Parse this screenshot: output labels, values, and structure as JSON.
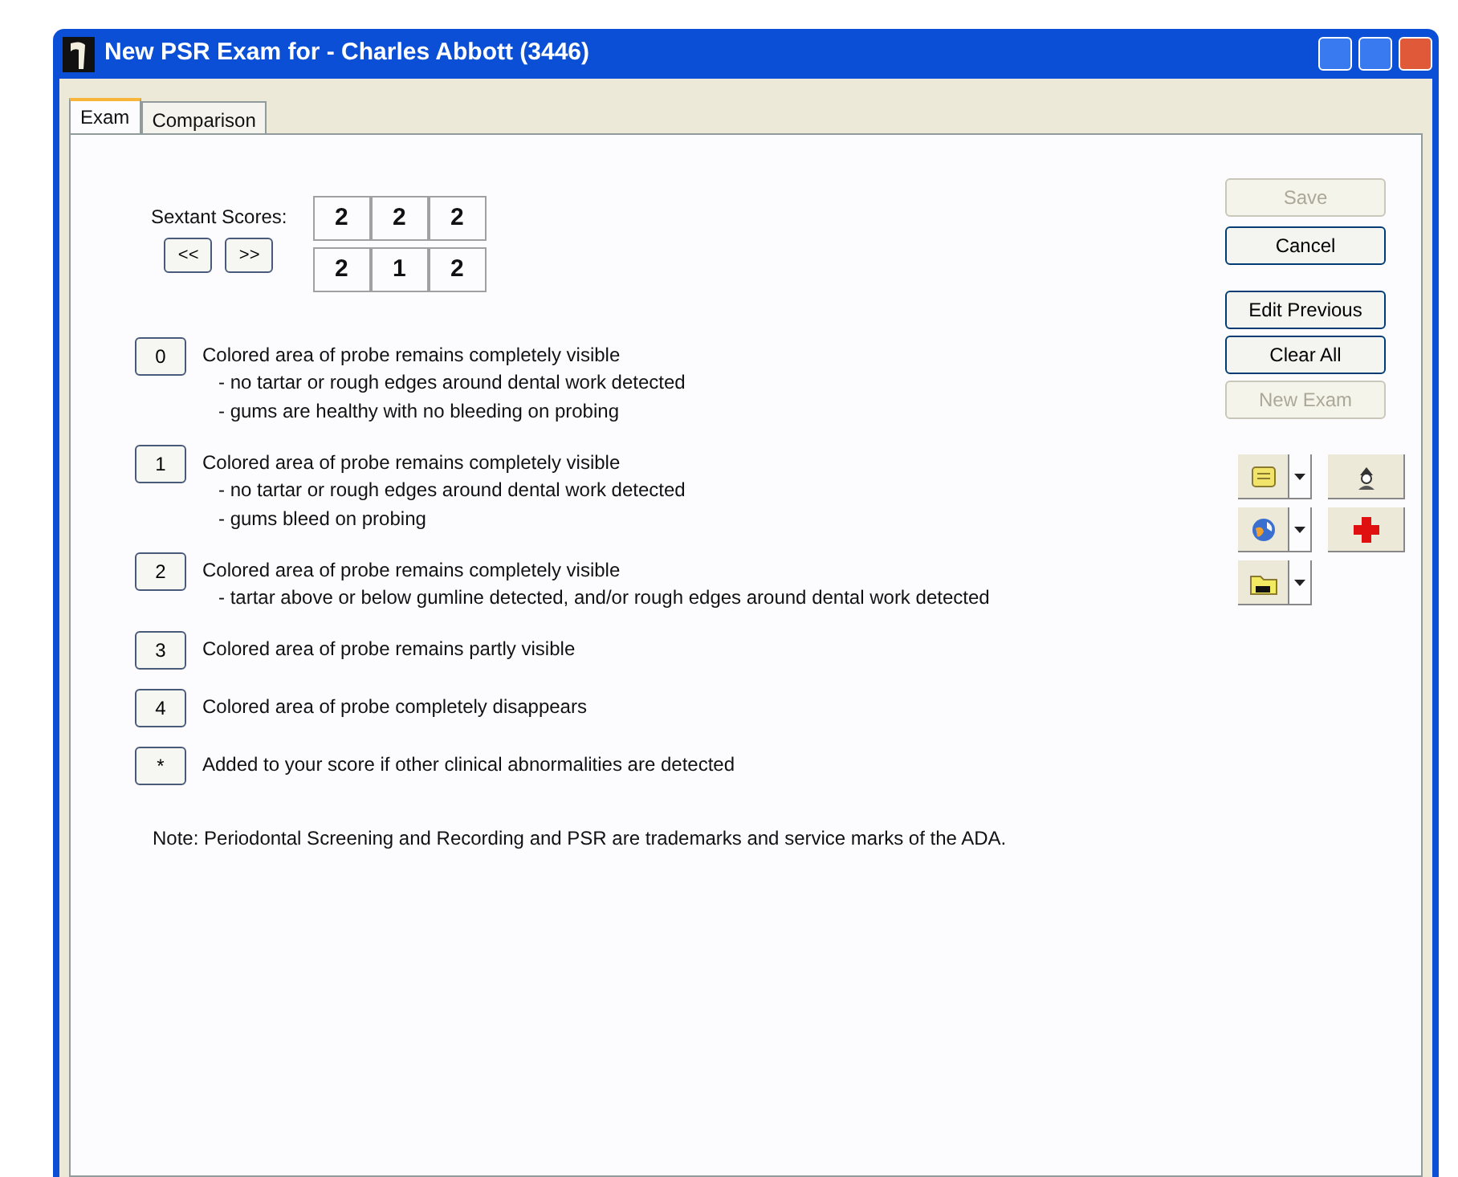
{
  "window": {
    "title": "New PSR Exam for - Charles Abbott (3446)"
  },
  "tabs": [
    {
      "label": "Exam",
      "selected": true
    },
    {
      "label": "Comparison",
      "selected": false
    }
  ],
  "sextant": {
    "label": "Sextant Scores:",
    "prev": "<<",
    "next": ">>",
    "rows": [
      [
        "2",
        "2",
        "2"
      ],
      [
        "2",
        "1",
        "2"
      ]
    ]
  },
  "codes": [
    {
      "key": "0",
      "lines": [
        "Colored area of probe remains completely visible",
        "- no tartar or rough edges around dental work detected",
        "- gums are healthy with no bleeding on probing"
      ]
    },
    {
      "key": "1",
      "lines": [
        "Colored area of probe remains completely visible",
        "- no tartar or rough edges around dental work detected",
        "- gums bleed on probing"
      ]
    },
    {
      "key": "2",
      "lines": [
        "Colored area of probe remains completely visible",
        "- tartar above or below gumline detected, and/or  rough edges around dental work detected"
      ]
    },
    {
      "key": "3",
      "lines": [
        "Colored area of probe remains partly visible"
      ]
    },
    {
      "key": "4",
      "lines": [
        "Colored area of probe completely disappears"
      ]
    },
    {
      "key": "*",
      "lines": [
        "Added to your score if other clinical abnormalities are detected"
      ]
    }
  ],
  "note": "Note: Periodontal Screening and Recording and PSR are trademarks and service marks of the ADA.",
  "buttons": [
    {
      "label": "Save",
      "disabled": true
    },
    {
      "label": "Cancel",
      "disabled": false
    },
    {
      "label": "Edit Previous",
      "disabled": false
    },
    {
      "label": "Clear All",
      "disabled": false
    },
    {
      "label": "New Exam",
      "disabled": true
    }
  ],
  "tools": [
    {
      "kind": "notes",
      "dropdown": true
    },
    {
      "kind": "figure",
      "dropdown": false
    },
    {
      "kind": "globe",
      "dropdown": true
    },
    {
      "kind": "cross",
      "dropdown": false
    },
    {
      "kind": "folder",
      "dropdown": true
    }
  ]
}
